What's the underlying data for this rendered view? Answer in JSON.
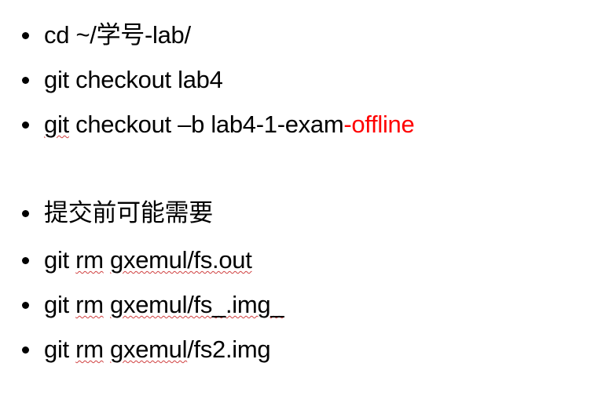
{
  "slide": {
    "lines": [
      {
        "pre": "cd ~/",
        "cjk": "学号",
        "post": "-lab/"
      },
      {
        "text": "git checkout lab4"
      },
      {
        "first": "git",
        "middle": " checkout –b lab4-1-exam",
        "red": "-offline"
      },
      {
        "text": "提交前可能需要"
      },
      {
        "first": "git",
        "gap": " ",
        "second": "rm",
        "gap2": " ",
        "third": "gxemul",
        "rest": "/fs.out"
      },
      {
        "first": "git",
        "gap": " ",
        "second": "rm",
        "gap2": " ",
        "third": "gxemul",
        "rest": "/fs_.img_"
      },
      {
        "first": "git",
        "gap": " ",
        "second": "rm",
        "gap2": " ",
        "third": "gxemul",
        "rest": "/fs2.img"
      }
    ]
  }
}
